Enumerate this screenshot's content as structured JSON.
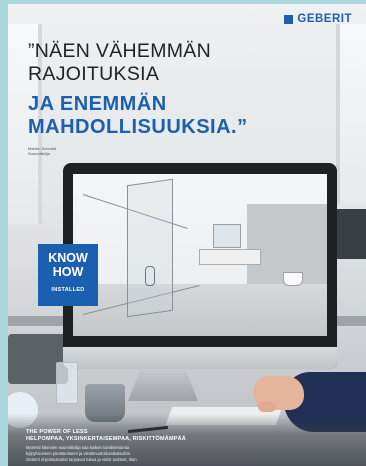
{
  "brand": {
    "name": "GEBERIT",
    "color": "#1b5fb0"
  },
  "headline": {
    "line1": "”NÄEN VÄHEMMÄN",
    "line2": "RAJOITUKSIA",
    "line3": "JA ENEMMÄN",
    "line4": "MAHDOLLISUUKSIA.”"
  },
  "attribution": {
    "name": "Marten Schmidt",
    "role": "Suunnittelija"
  },
  "badge": {
    "line1": "KNOW",
    "line2": "HOW",
    "line3": "INSTALLED"
  },
  "bottom": {
    "heading1": "THE POWER OF LESS",
    "heading2": "HELPOMPAA, YKSINKERTAISEMPAA, RISKITTÖMÄMPÄÄ",
    "body": [
      "Monesti kätevien suunnittelija saa kaiken tarvitsemansa",
      "kylpyhuoneen pientämiseen ja viestimuotoiluratkaisuihin.",
      "Geberit ohjeistustustot tarjoavat tukea ja vinkit tuotteet, tilan"
    ]
  }
}
